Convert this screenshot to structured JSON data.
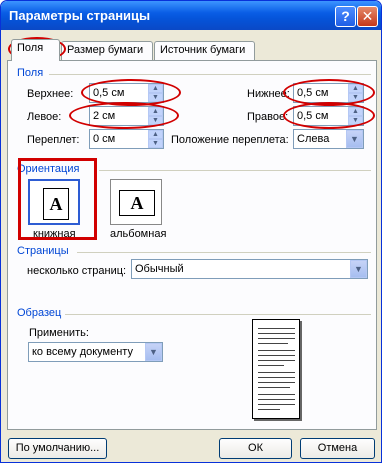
{
  "window": {
    "title": "Параметры страницы",
    "help_label": "?",
    "close_label": "✕"
  },
  "tabs": [
    {
      "label": "Поля"
    },
    {
      "label": "Размер бумаги"
    },
    {
      "label": "Источник бумаги"
    }
  ],
  "margins": {
    "group_label": "Поля",
    "top": {
      "label": "Верхнее:",
      "value": "0,5 см"
    },
    "bottom": {
      "label": "Нижнее:",
      "value": "0,5 см"
    },
    "left": {
      "label": "Левое:",
      "value": "2 см"
    },
    "right": {
      "label": "Правое:",
      "value": "0,5 см"
    },
    "gutter": {
      "label": "Переплет:",
      "value": "0 см"
    },
    "gutter_position": {
      "label": "Положение переплета:",
      "value": "Слева"
    }
  },
  "orientation": {
    "group_label": "Ориентация",
    "portrait_label": "книжная",
    "landscape_label": "альбомная",
    "icon_letter": "A"
  },
  "pages": {
    "group_label": "Страницы",
    "multiple_label": "несколько страниц:",
    "multiple_value": "Обычный"
  },
  "preview": {
    "group_label": "Образец",
    "apply_label": "Применить:",
    "apply_value": "ко всему документу"
  },
  "footer": {
    "default_label": "По умолчанию...",
    "ok_label": "ОК",
    "cancel_label": "Отмена"
  },
  "colors": {
    "title_bar": "#0a5ee6",
    "group_label": "#0046d5",
    "highlight": "#d10000"
  }
}
